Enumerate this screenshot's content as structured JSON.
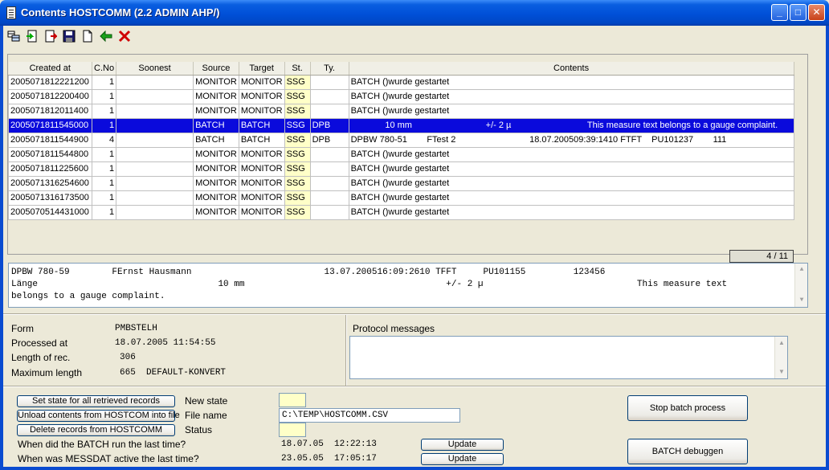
{
  "window": {
    "title": "Contents HOSTCOMM (2.2 ADMIN AHP/)",
    "minimize": "_",
    "maximize": "□",
    "close": "✕"
  },
  "toolbar": {
    "icons": [
      "grid-icon",
      "import-icon",
      "export-icon",
      "save-icon",
      "new-document-icon",
      "back-arrow-icon",
      "delete-icon"
    ]
  },
  "grid": {
    "columns": [
      "Created at",
      "C.No",
      "Soonest",
      "Source",
      "Target",
      "St.",
      "Ty.",
      "Contents"
    ],
    "rows": [
      {
        "created": "2005071812221200",
        "cno": "1",
        "soonest": "",
        "source": "MONITOR",
        "target": "MONITOR",
        "st": "SSG",
        "ty": "",
        "contents": "BATCH ()wurde gestartet"
      },
      {
        "created": "2005071812200400",
        "cno": "1",
        "soonest": "",
        "source": "MONITOR",
        "target": "MONITOR",
        "st": "SSG",
        "ty": "",
        "contents": "BATCH ()wurde gestartet"
      },
      {
        "created": "2005071812011400",
        "cno": "1",
        "soonest": "",
        "source": "MONITOR",
        "target": "MONITOR",
        "st": "SSG",
        "ty": "",
        "contents": "BATCH ()wurde gestartet"
      },
      {
        "created": "2005071811545000",
        "cno": "1",
        "soonest": "",
        "source": "BATCH",
        "target": "BATCH",
        "st": "SSG",
        "ty": "DPB",
        "contents": "              10 mm                              +/- 2 µ                               This measure text belongs to a gauge complaint."
      },
      {
        "created": "2005071811544900",
        "cno": "4",
        "soonest": "",
        "source": "BATCH",
        "target": "BATCH",
        "st": "SSG",
        "ty": "DPB",
        "contents": "DPBW 780-51        FTest 2                              18.07.200509:39:1410 FTFT    PU101237        111"
      },
      {
        "created": "2005071811544800",
        "cno": "1",
        "soonest": "",
        "source": "MONITOR",
        "target": "MONITOR",
        "st": "SSG",
        "ty": "",
        "contents": "BATCH ()wurde gestartet"
      },
      {
        "created": "2005071811225600",
        "cno": "1",
        "soonest": "",
        "source": "MONITOR",
        "target": "MONITOR",
        "st": "SSG",
        "ty": "",
        "contents": "BATCH ()wurde gestartet"
      },
      {
        "created": "2005071316254600",
        "cno": "1",
        "soonest": "",
        "source": "MONITOR",
        "target": "MONITOR",
        "st": "SSG",
        "ty": "",
        "contents": "BATCH ()wurde gestartet"
      },
      {
        "created": "2005071316173500",
        "cno": "1",
        "soonest": "",
        "source": "MONITOR",
        "target": "MONITOR",
        "st": "SSG",
        "ty": "",
        "contents": "BATCH ()wurde gestartet"
      },
      {
        "created": "2005070514431000",
        "cno": "1",
        "soonest": "",
        "source": "MONITOR",
        "target": "MONITOR",
        "st": "SSG",
        "ty": "",
        "contents": "BATCH ()wurde gestartet"
      }
    ],
    "selected_index": 3,
    "counter": "4 / 11"
  },
  "contents_text": {
    "line1": "DPBW 780-59        FErnst Hausmann                         13.07.200516:09:2610 TFFT     PU101155         123456",
    "line2": "Länge                                  10 mm                                      +/- 2 µ                             This measure text",
    "line3": "belongs to a gauge complaint."
  },
  "info": {
    "form_label": "Form",
    "form_value": "PMBSTELH",
    "processed_label": "Processed at",
    "processed_value": "18.07.2005 11:54:55",
    "length_label": "Length of rec.",
    "length_value": "306",
    "maxlen_label": "Maximum length",
    "maxlen_value": "665  DEFAULT-KONVERT"
  },
  "protocol": {
    "label": "Protocol messages"
  },
  "actions": {
    "set_state": "Set state for all retrieved records",
    "unload": "Unload contents from HOSTCOM into file",
    "delete": "Delete records from HOSTCOMM",
    "new_state_label": "New state",
    "file_name_label": "File name",
    "file_name_value": "C:\\TEMP\\HOSTCOMM.CSV",
    "status_label": "Status",
    "batch_q": "When did the BATCH run the last time?",
    "batch_time": "18.07.05  12:22:13",
    "messdat_q": "When was MESSDAT active the last time?",
    "messdat_time": "23.05.05  17:05:17",
    "update1": "Update",
    "update2": "Update",
    "stop_batch": "Stop batch process",
    "batch_debug": "BATCH debuggen"
  }
}
